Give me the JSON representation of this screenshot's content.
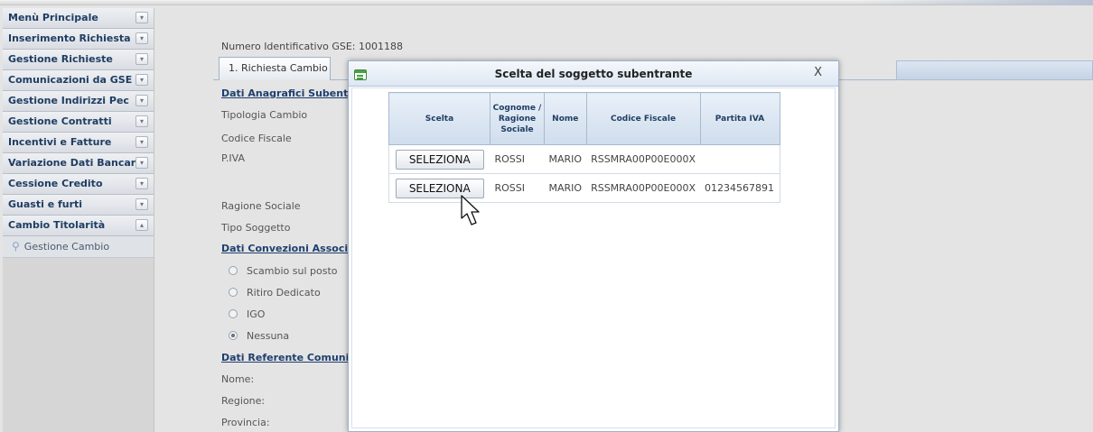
{
  "sidebar": {
    "items": [
      {
        "label": "Menù Principale",
        "toggle": "▾"
      },
      {
        "label": "Inserimento Richiesta",
        "toggle": "▾"
      },
      {
        "label": "Gestione Richieste",
        "toggle": "▾"
      },
      {
        "label": "Comunicazioni da GSE",
        "toggle": "▾"
      },
      {
        "label": "Gestione Indirizzi Pec",
        "toggle": "▾"
      },
      {
        "label": "Gestione Contratti",
        "toggle": "▾"
      },
      {
        "label": "Incentivi e Fatture",
        "toggle": "▾"
      },
      {
        "label": "Variazione Dati Bancari",
        "toggle": "▾"
      },
      {
        "label": "Cessione Credito",
        "toggle": "▾"
      },
      {
        "label": "Guasti e furti",
        "toggle": "▾"
      },
      {
        "label": "Cambio Titolarità",
        "toggle": "▴"
      }
    ],
    "subitem": {
      "label": "Gestione Cambio",
      "icon": "search-icon"
    }
  },
  "main": {
    "ident": "Numero Identificativo GSE: 1001188",
    "tab": "1. Richiesta Cambio",
    "section_anagrafici": "Dati Anagrafici Subentra",
    "fields": {
      "tipologia": "Tipologia Cambio",
      "codice_fiscale": "Codice Fiscale",
      "piva": "P.IVA",
      "ragione_sociale": "Ragione Sociale",
      "tipo_soggetto": "Tipo Soggetto"
    },
    "section_convenzioni": "Dati Convezioni Associat",
    "radios": [
      {
        "label": "Scambio sul posto",
        "checked": false
      },
      {
        "label": "Ritiro Dedicato",
        "checked": false
      },
      {
        "label": "IGO",
        "checked": false
      },
      {
        "label": "Nessuna",
        "checked": true
      }
    ],
    "section_referente": "Dati Referente Comunica",
    "referente_fields": {
      "nome": "Nome:",
      "regione": "Regione:",
      "provincia": "Provincia:"
    }
  },
  "modal": {
    "title": "Scelta del soggetto subentrante",
    "close": "X",
    "columns": [
      "Scelta",
      "Cognome / Ragione Sociale",
      "Nome",
      "Codice Fiscale",
      "Partita IVA"
    ],
    "rows": [
      {
        "button": "SELEZIONA",
        "cognome": "ROSSI",
        "nome": "MARIO",
        "codice_fiscale": "RSSMRA00P00E000X",
        "partita_iva": ""
      },
      {
        "button": "SELEZIONA",
        "cognome": "ROSSI",
        "nome": "MARIO",
        "codice_fiscale": "RSSMRA00P00E000X",
        "partita_iva": "01234567891"
      }
    ]
  },
  "colors": {
    "sidebar_text": "#1f3d63",
    "header_text": "#213e64",
    "background": "#e4e4e4"
  }
}
